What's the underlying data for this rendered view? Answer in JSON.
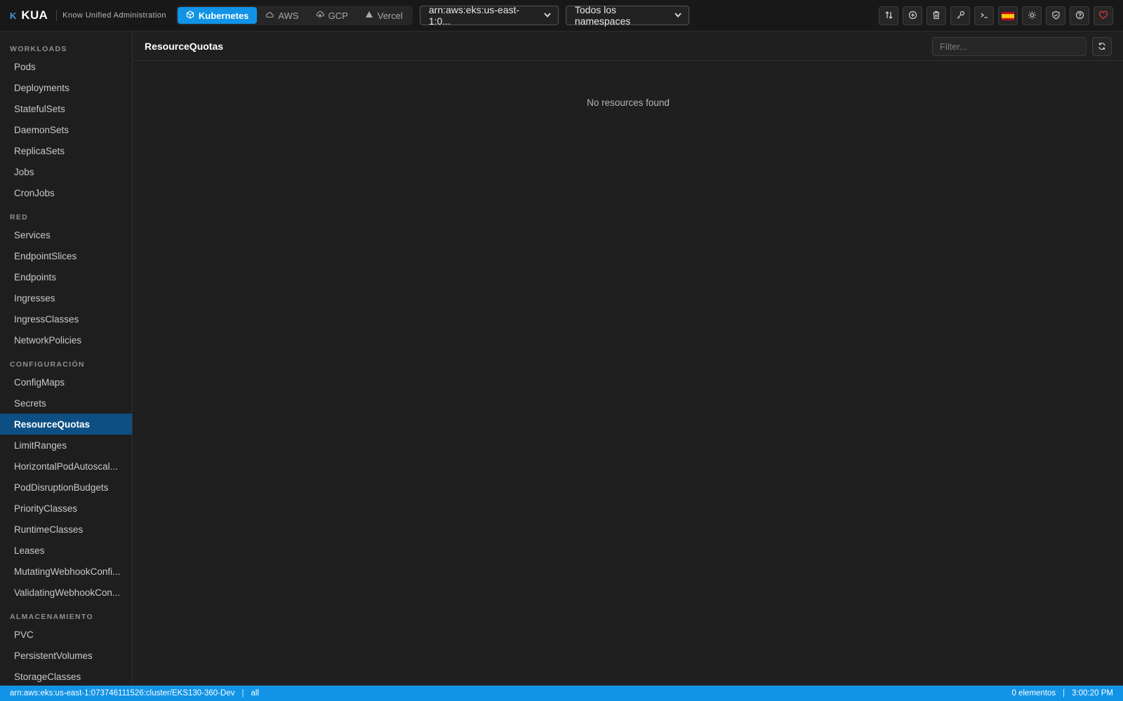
{
  "brand": {
    "logo_glyph": "K",
    "name": "KUA",
    "subtitle": "Know Unified Administration"
  },
  "provider_tabs": [
    {
      "label": "Kubernetes",
      "icon": "cube-icon",
      "active": true
    },
    {
      "label": "AWS",
      "icon": "cloud-icon",
      "active": false
    },
    {
      "label": "GCP",
      "icon": "cloud-upload-icon",
      "active": false
    },
    {
      "label": "Vercel",
      "icon": "triangle-icon",
      "active": false
    }
  ],
  "context_select": {
    "value": "arn:aws:eks:us-east-1:0..."
  },
  "namespace_select": {
    "value": "Todos los namespaces"
  },
  "toolbar_icons": [
    "compare-icon",
    "add-circle-icon",
    "trash-icon",
    "key-icon",
    "terminal-icon",
    "spain-flag-icon",
    "sun-icon",
    "shield-icon",
    "help-icon",
    "heart-icon"
  ],
  "sidebar": {
    "sections": [
      {
        "title": "WORKLOADS",
        "items": [
          "Pods",
          "Deployments",
          "StatefulSets",
          "DaemonSets",
          "ReplicaSets",
          "Jobs",
          "CronJobs"
        ]
      },
      {
        "title": "RED",
        "items": [
          "Services",
          "EndpointSlices",
          "Endpoints",
          "Ingresses",
          "IngressClasses",
          "NetworkPolicies"
        ]
      },
      {
        "title": "CONFIGURACIÓN",
        "items": [
          "ConfigMaps",
          "Secrets",
          "ResourceQuotas",
          "LimitRanges",
          "HorizontalPodAutoscal...",
          "PodDisruptionBudgets",
          "PriorityClasses",
          "RuntimeClasses",
          "Leases",
          "MutatingWebhookConfi...",
          "ValidatingWebhookCon..."
        ]
      },
      {
        "title": "ALMACENAMIENTO",
        "items": [
          "PVC",
          "PersistentVolumes",
          "StorageClasses"
        ]
      }
    ],
    "active_item": "ResourceQuotas"
  },
  "main": {
    "title": "ResourceQuotas",
    "filter_placeholder": "Filter...",
    "filter_value": "",
    "empty_message": "No resources found"
  },
  "statusbar": {
    "context": "arn:aws:eks:us-east-1:073746111526:cluster/EKS130-360-Dev",
    "separator": "|",
    "namespace": "all",
    "count": "0 elementos",
    "time": "3:00:20 PM"
  },
  "colors": {
    "accent": "#1193e6",
    "active_nav": "#0e4f83",
    "background": "#1f1f1f",
    "heart": "#e23b3b"
  }
}
